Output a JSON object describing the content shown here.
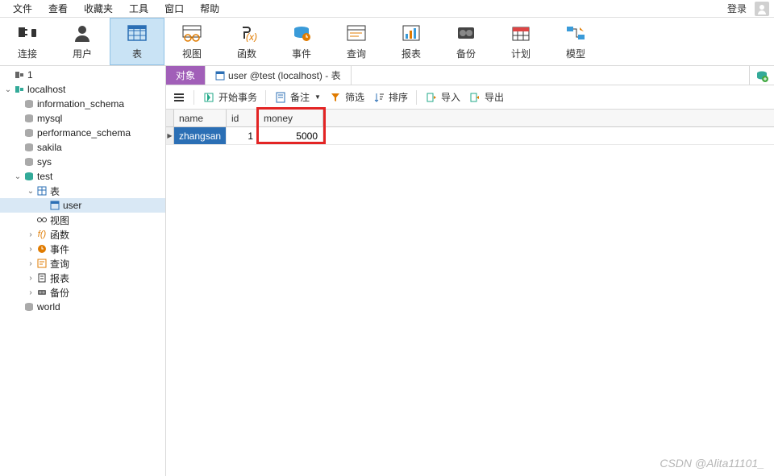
{
  "menu": {
    "file": "文件",
    "view": "查看",
    "favorites": "收藏夹",
    "tools": "工具",
    "window": "窗口",
    "help": "帮助",
    "login": "登录"
  },
  "toolbar": {
    "connection": "连接",
    "user": "用户",
    "table": "表",
    "view": "视图",
    "function": "函数",
    "event": "事件",
    "query": "查询",
    "report": "报表",
    "backup": "备份",
    "schedule": "计划",
    "model": "模型"
  },
  "tree": {
    "root": "1",
    "conn": "localhost",
    "dbs": [
      "information_schema",
      "mysql",
      "performance_schema",
      "sakila",
      "sys",
      "test"
    ],
    "test_children": {
      "tables": "表",
      "user": "user",
      "views": "视图",
      "functions": "函数",
      "events": "事件",
      "queries": "查询",
      "reports": "报表",
      "backups": "备份"
    },
    "world": "world"
  },
  "tabs": {
    "objects": "对象",
    "data": "user @test (localhost) - 表"
  },
  "subtoolbar": {
    "begin": "开始事务",
    "note": "备注",
    "filter": "筛选",
    "sort": "排序",
    "import": "导入",
    "export": "导出"
  },
  "grid": {
    "columns": [
      "name",
      "id",
      "money"
    ],
    "rows": [
      {
        "name": "zhangsan",
        "id": "1",
        "money": "5000"
      }
    ]
  },
  "watermark": "CSDN @Alita11101_"
}
